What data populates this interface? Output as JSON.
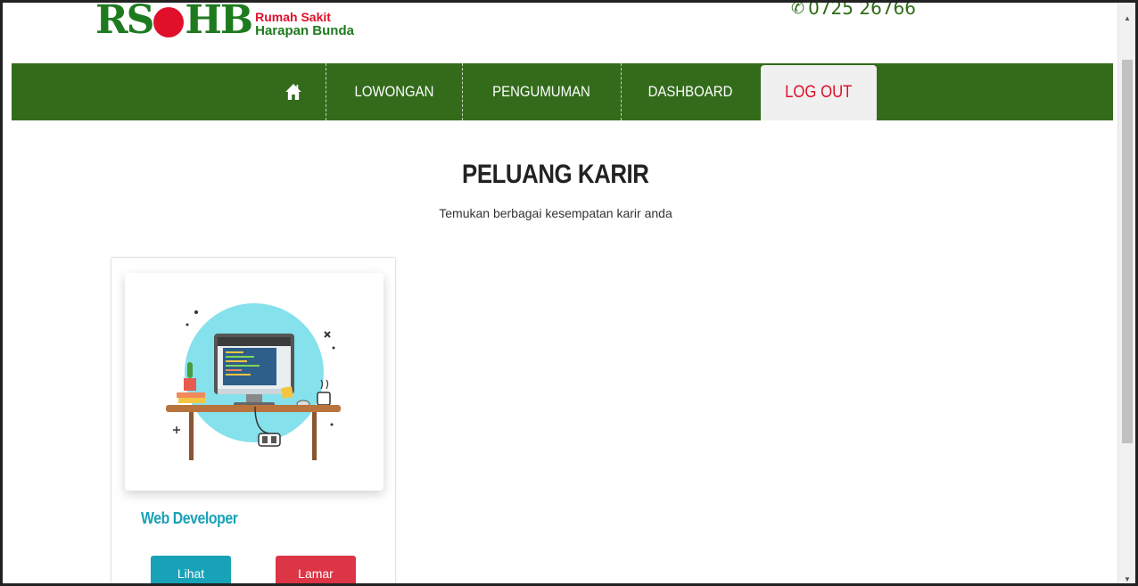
{
  "header": {
    "logo_letters_left": "RS",
    "logo_letters_right": "HB",
    "logo_line1": "Rumah Sakit",
    "logo_line2": "Harapan Bunda",
    "phone": "0725 26766"
  },
  "nav": {
    "lowongan": "LOWONGAN",
    "pengumuman": "PENGUMUMAN",
    "dashboard": "DASHBOARD",
    "logout": "LOG OUT"
  },
  "main": {
    "title": "PELUANG KARIR",
    "subtitle": "Temukan berbagai kesempatan karir anda"
  },
  "card": {
    "job_title": "Web Developer",
    "view_label": "Lihat",
    "apply_label": "Lamar"
  },
  "colors": {
    "nav_green": "#336b1b",
    "logo_green": "#1e7a1e",
    "brand_red": "#e0102a",
    "teal": "#17a2b8",
    "danger": "#dc3545"
  }
}
